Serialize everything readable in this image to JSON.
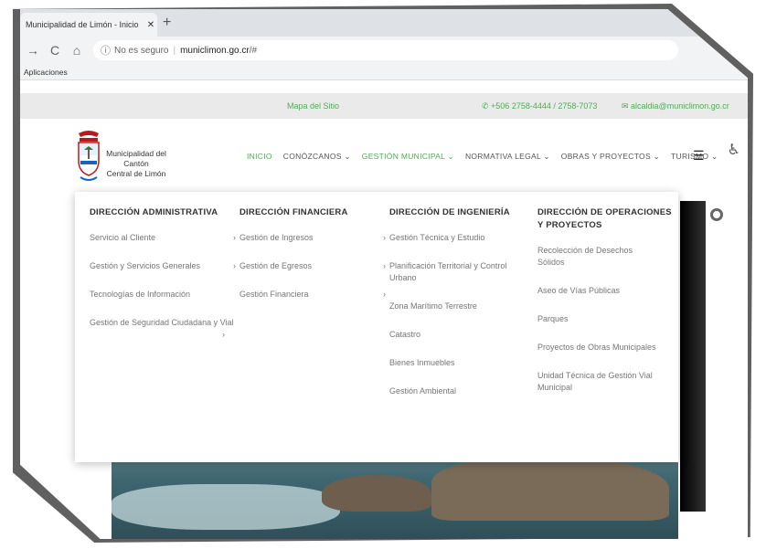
{
  "browser": {
    "tab_title": "Municipalidad de Limón - Inicio",
    "tab_close": "✕",
    "new_tab": "+",
    "back": "→",
    "reload": "C",
    "home": "⌂",
    "security_icon": "ⓘ",
    "security_label": "No es seguro",
    "url_domain": "municlimon.go.cr",
    "url_path": "/#",
    "bookmarks_label": "Aplicaciones"
  },
  "topbar": {
    "sitemap": "Mapa del Sitio",
    "phone": "✆ +506 2758-4444 / 2758-7073",
    "email": "✉ alcaldia@municlimon.go.cr"
  },
  "header": {
    "brand_line1": "Municipalidad del Cantón",
    "brand_line2": "Central de Limón",
    "nav": [
      {
        "label": "INICIO"
      },
      {
        "label": "CONÓZCANOS ⌄"
      },
      {
        "label": "GESTIÓN MUNICIPAL ⌄"
      },
      {
        "label": "NORMATIVA LEGAL ⌄"
      },
      {
        "label": "OBRAS Y PROYECTOS ⌄"
      },
      {
        "label": "TURISMO ⌄"
      }
    ],
    "menu_icon": "☰",
    "accessibility_icon": "♿"
  },
  "megamenu": {
    "columns": [
      {
        "title": "DIRECCIÓN ADMINISTRATIVA",
        "items": [
          {
            "label": "Servicio al Cliente",
            "chev": "›"
          },
          {
            "label": "Gestión y Servicios Generales",
            "chev": "›"
          },
          {
            "label": "Tecnologías de Información",
            "chev": ""
          },
          {
            "label": "Gestión de Seguridad Ciudadana y Vial",
            "chev": "›"
          }
        ]
      },
      {
        "title": "DIRECCIÓN FINANCIERA",
        "items": [
          {
            "label": "Gestión de Ingresos",
            "chev": "›"
          },
          {
            "label": "Gestión de Egresos",
            "chev": "›"
          },
          {
            "label": "Gestión Financiera",
            "chev": "›"
          }
        ]
      },
      {
        "title": "DIRECCIÓN DE INGENIERÍA",
        "items": [
          {
            "label": "Gestión Técnica y Estudio",
            "chev": ""
          },
          {
            "label": "Planificación Territorial y Control Urbano",
            "chev": ""
          },
          {
            "label": "Zona Marítimo Terrestre",
            "chev": ""
          },
          {
            "label": "Catastro",
            "chev": ""
          },
          {
            "label": "Bienes Inmuebles",
            "chev": ""
          },
          {
            "label": "Gestión Ambiental",
            "chev": ""
          }
        ]
      },
      {
        "title": "DIRECCIÓN DE OPERACIONES Y PROYECTOS",
        "items": [
          {
            "label": "Recolección de Desechos Sólidos",
            "chev": ""
          },
          {
            "label": "Aseo de Vías Públicas",
            "chev": ""
          },
          {
            "label": "Parques",
            "chev": ""
          },
          {
            "label": "Proyectos de Obras Municipales",
            "chev": ""
          },
          {
            "label": "Unidad Técnica de Gestión Vial Municipal",
            "chev": ""
          }
        ]
      }
    ]
  },
  "colors": {
    "accent": "#4caf50",
    "topbar_bg": "#eaeaea"
  }
}
